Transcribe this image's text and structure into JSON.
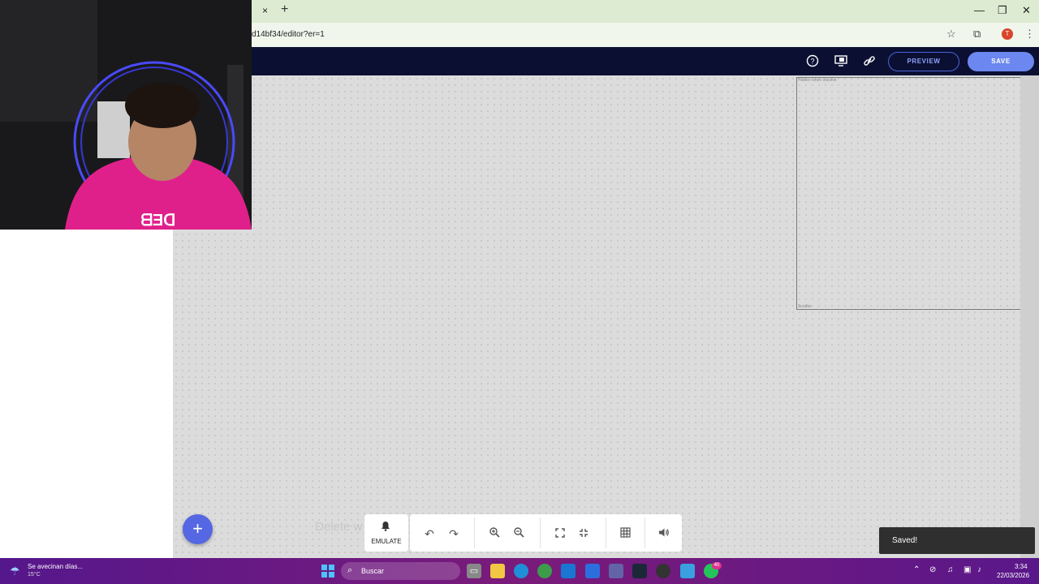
{
  "browser": {
    "new_tab": "+",
    "tab_close": "×",
    "url": "d14bf34/editor?er=1",
    "profile_initial": "T",
    "window_controls": [
      "—",
      "❐",
      "✕"
    ]
  },
  "header": {
    "preview_label": "PREVIEW",
    "save_label": "SAVE"
  },
  "canvas": {
    "frame_title": "Hidden when inactive",
    "frame_footer": "Scroller",
    "hint": "Delete w"
  },
  "toolbar": {
    "emulate_label": "EMULATE"
  },
  "toast": {
    "text": "Saved!"
  },
  "taskbar": {
    "weather_title": "Se avecinan días...",
    "weather_temp": "15°C",
    "search_placeholder": "Buscar",
    "time": "3:34",
    "date": "22/03/2026",
    "notification_count": "40"
  },
  "colors": {
    "accent": "#6d87f0",
    "header_bg": "#0b1033",
    "fab": "#5567e2",
    "tab_bar": "#dcebd2",
    "taskbar": "#6a1a85"
  },
  "icons": [
    "help-icon",
    "screen-icon",
    "link-icon",
    "bell-icon",
    "undo-icon",
    "redo-icon",
    "zoom-in-icon",
    "zoom-out-icon",
    "fullscreen-icon",
    "exit-fullscreen-icon",
    "grid-icon",
    "volume-icon",
    "plus-icon"
  ]
}
